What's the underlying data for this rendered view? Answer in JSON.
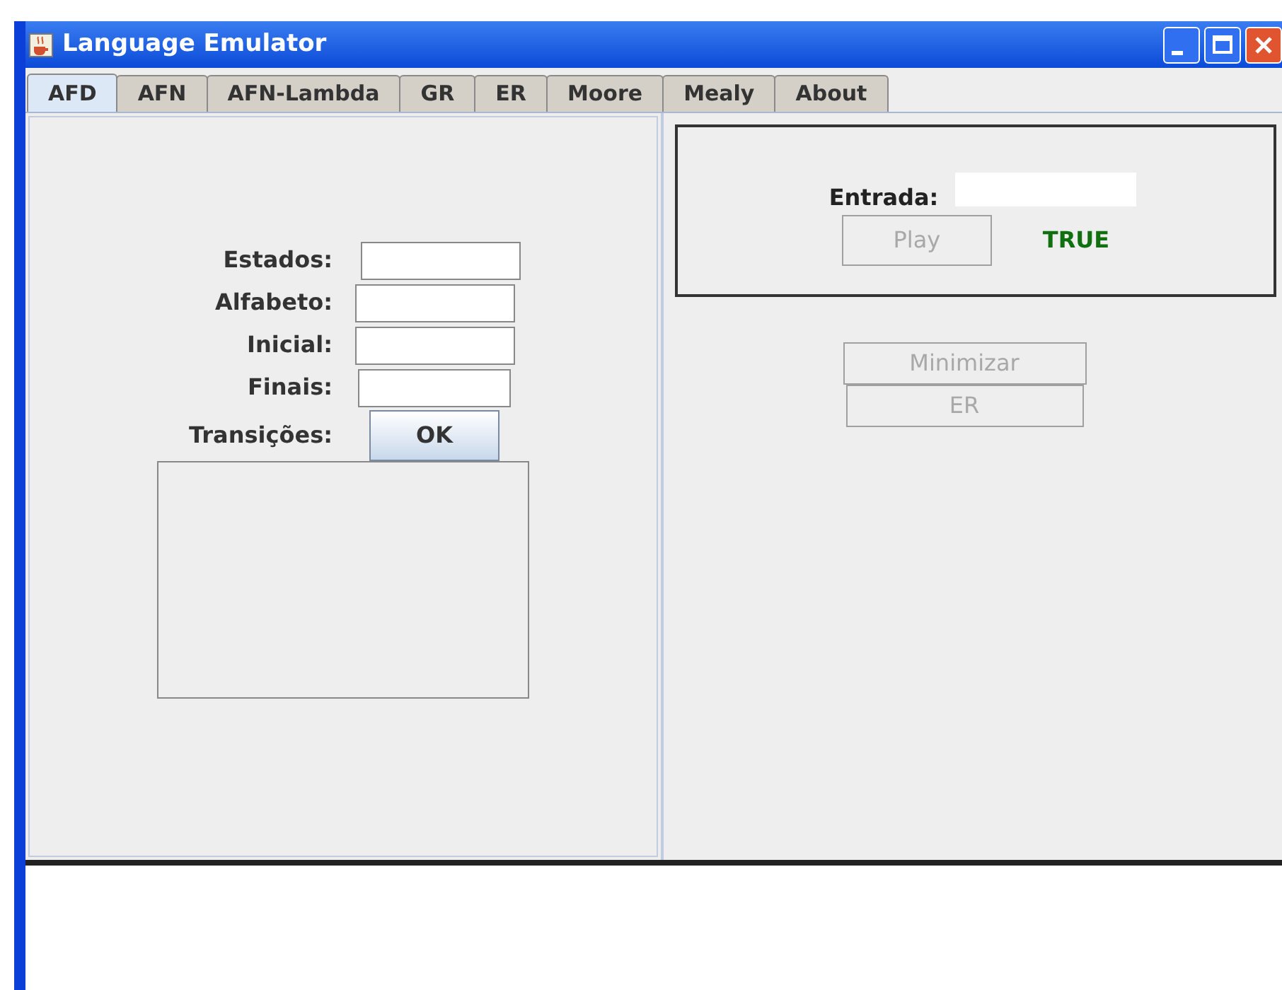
{
  "window": {
    "title": "Language Emulator"
  },
  "tabs": [
    {
      "label": "AFD",
      "selected": true
    },
    {
      "label": "AFN",
      "selected": false
    },
    {
      "label": "AFN-Lambda",
      "selected": false
    },
    {
      "label": "GR",
      "selected": false
    },
    {
      "label": "ER",
      "selected": false
    },
    {
      "label": "Moore",
      "selected": false
    },
    {
      "label": "Mealy",
      "selected": false
    },
    {
      "label": "About",
      "selected": false
    }
  ],
  "form": {
    "fields": [
      {
        "label": "Estados:"
      },
      {
        "label": "Alfabeto:"
      },
      {
        "label": "Inicial:"
      },
      {
        "label": "Finais:"
      }
    ],
    "transitions_label": "Transições:",
    "ok_button": {
      "label": "OK",
      "disabled": false
    }
  },
  "input_panel": {
    "label": "Entrada:",
    "play_button": {
      "label": "Play",
      "disabled": true
    },
    "result": "TRUE"
  },
  "actions": [
    {
      "label": "Minimizar",
      "disabled": true
    },
    {
      "label": "ER",
      "disabled": true
    }
  ]
}
